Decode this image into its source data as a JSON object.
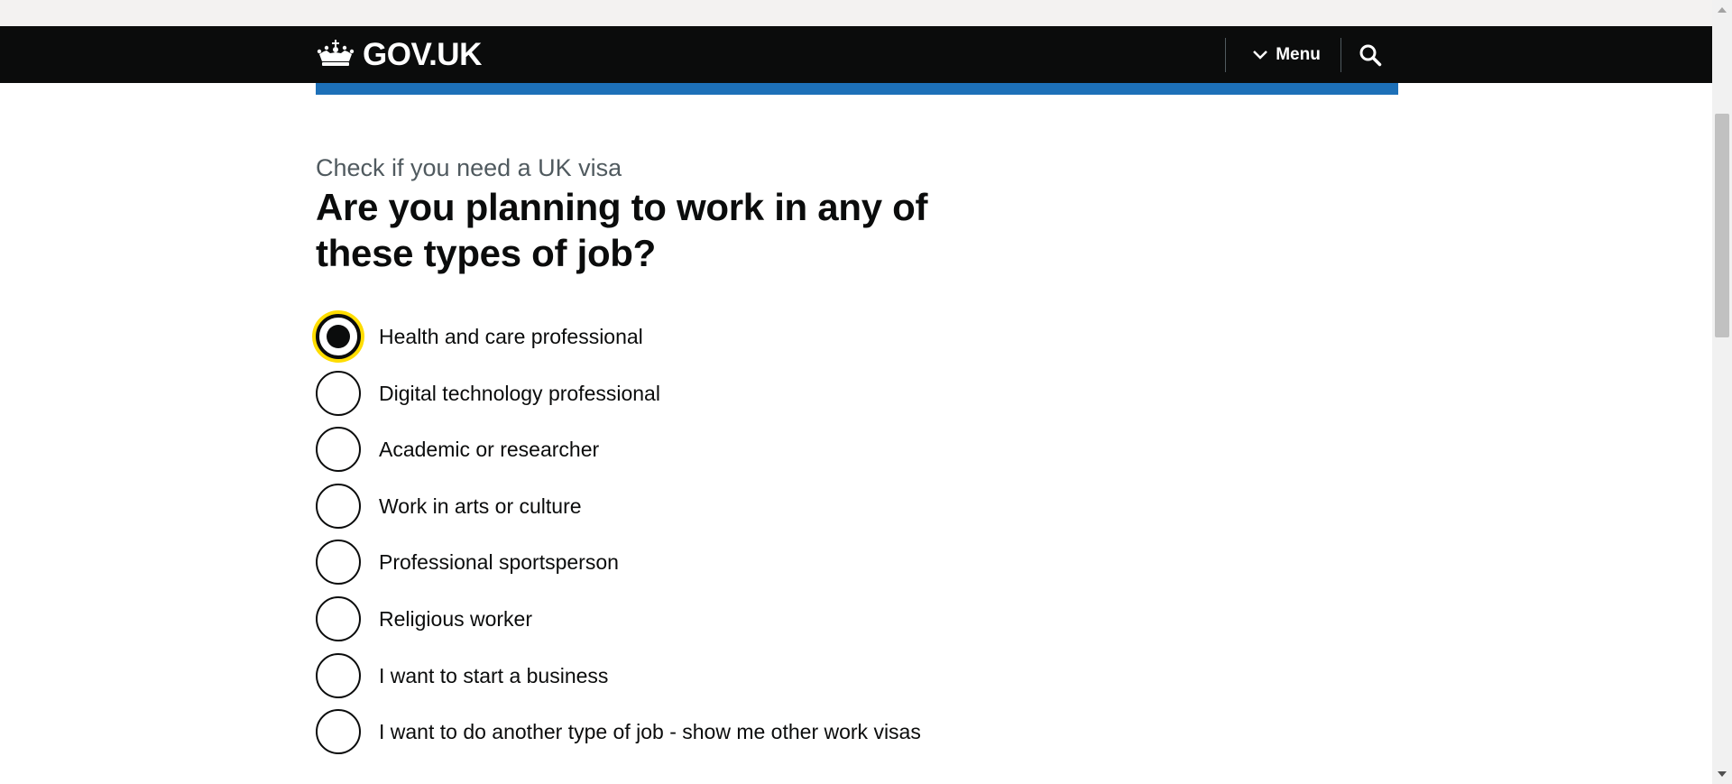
{
  "header": {
    "logo_text": "GOV.UK",
    "menu_label": "Menu",
    "logo_icon": "crown-icon",
    "menu_icon": "chevron-down-icon",
    "search_icon": "search-icon",
    "background_color": "#0b0c0c",
    "accent_bar_color": "#1d70b8"
  },
  "main": {
    "caption": "Check if you need a UK visa",
    "heading": "Are you planning to work in any of these types of job?",
    "options": [
      {
        "label": "Health and care professional",
        "checked": true
      },
      {
        "label": "Digital technology professional",
        "checked": false
      },
      {
        "label": "Academic or researcher",
        "checked": false
      },
      {
        "label": "Work in arts or culture",
        "checked": false
      },
      {
        "label": "Professional sportsperson",
        "checked": false
      },
      {
        "label": "Religious worker",
        "checked": false
      },
      {
        "label": "I want to start a business",
        "checked": false
      },
      {
        "label": "I want to do another type of job - show me other work visas",
        "checked": false
      }
    ],
    "focus_color": "#ffdd00"
  }
}
